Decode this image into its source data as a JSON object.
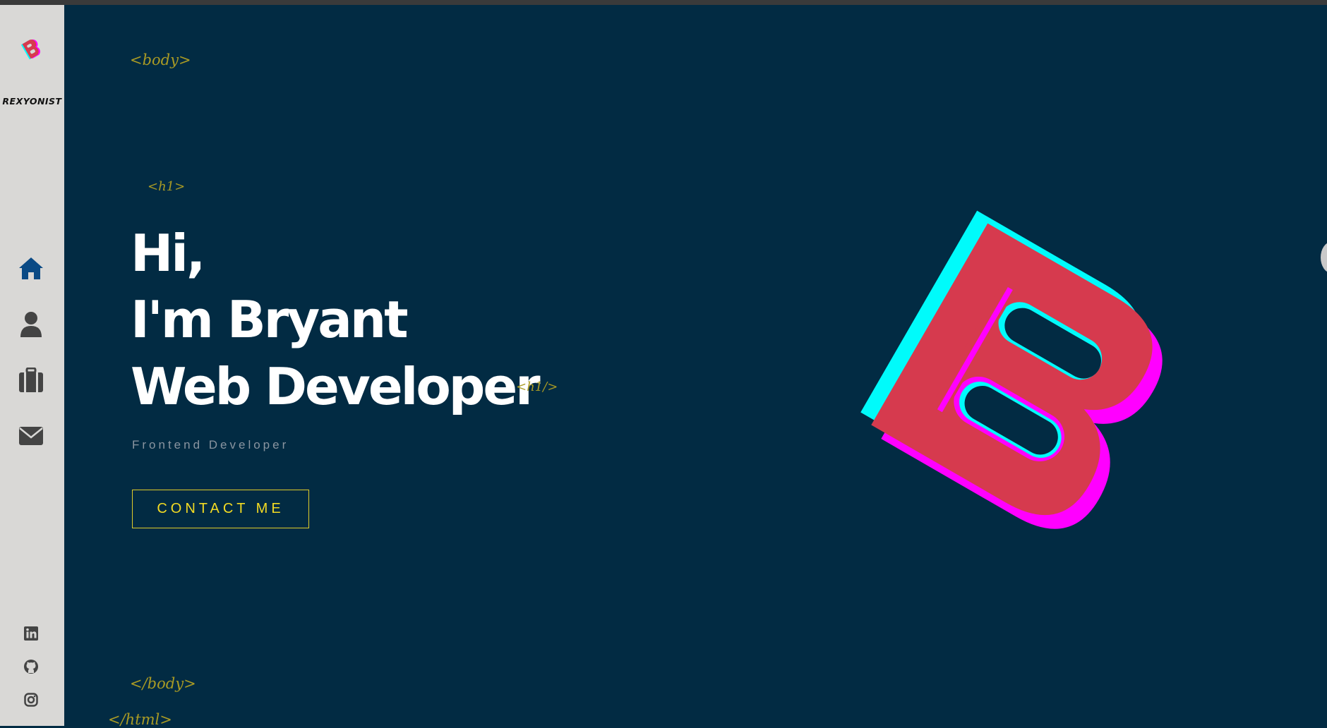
{
  "brand": {
    "name": "REXYONIST",
    "logo_icon": "b-logo-icon"
  },
  "nav": {
    "items": [
      {
        "icon": "home-icon",
        "active": true
      },
      {
        "icon": "user-icon",
        "active": false
      },
      {
        "icon": "briefcase-icon",
        "active": false
      },
      {
        "icon": "envelope-icon",
        "active": false
      }
    ]
  },
  "social": {
    "items": [
      {
        "icon": "linkedin-icon"
      },
      {
        "icon": "github-icon"
      },
      {
        "icon": "instagram-icon"
      }
    ]
  },
  "tags": {
    "body_open": "<body>",
    "h1_open": "<h1>",
    "h1_close": "<h1/>",
    "body_close": "</body>",
    "html_close": "</html>"
  },
  "hero": {
    "line1": "Hi,",
    "line2": "I'm Bryant",
    "line3": "Web Developer",
    "subtitle": "Frontend Developer",
    "cta_label": "CONTACT ME"
  },
  "colors": {
    "background": "#022b43",
    "sidebar": "#d9d8d6",
    "accent_yellow": "#f3db23",
    "tag_color": "#a99a24",
    "logo_red": "#d63a4e",
    "logo_cyan": "#00fbfb",
    "logo_magenta": "#ff00ff",
    "nav_active": "#0a4a85",
    "nav_inactive": "#444444"
  }
}
